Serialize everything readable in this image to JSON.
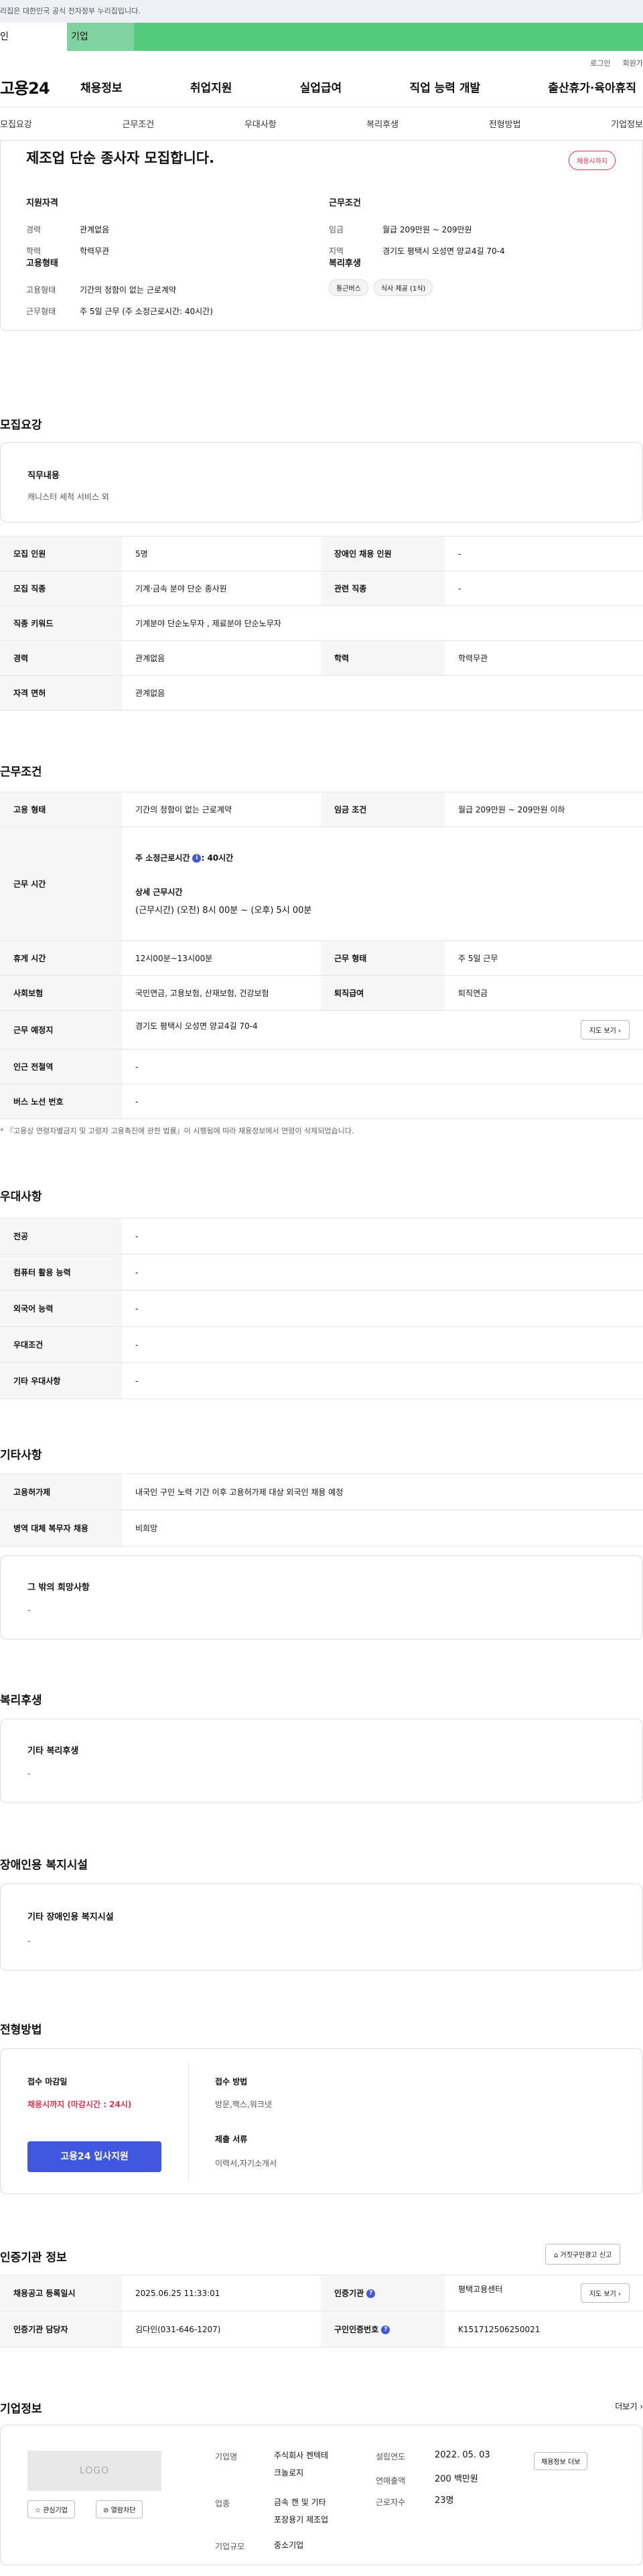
{
  "gov_banner": "이 누리집은 대한민국 공식 전자정부 누리집입니다.",
  "gov_banner_visible": "리집은 대한민국 공식 전자정부 누리집입니다.",
  "portal_tabs": [
    "인",
    "기업"
  ],
  "util": [
    "로그인",
    "회원가"
  ],
  "logo": "고용24",
  "gnb": [
    "채용정보",
    "취업지원",
    "실업급여",
    "직업 능력 개발",
    "출산휴가·육아휴직"
  ],
  "subtabs": [
    "모집요강",
    "근무조건",
    "우대사항",
    "복리후생",
    "전형방법",
    "기업정보"
  ],
  "title": "제조업 단순 종사자 모집합니다.",
  "status_pill": "채용시까지",
  "qual": {
    "heading": "지원자격",
    "rows": [
      {
        "k": "경력",
        "v": "관계없음"
      },
      {
        "k": "학력",
        "v": "학력무관"
      }
    ]
  },
  "emp": {
    "heading": "고용형태",
    "rows": [
      {
        "k": "고용형태",
        "v": "기간의 정함이 없는 근로계약"
      },
      {
        "k": "근무형태",
        "v": "주 5일 근무 (주 소정근로시간: 40시간)"
      }
    ]
  },
  "work": {
    "heading": "근무조건",
    "rows": [
      {
        "k": "임금",
        "v": "월급 209만원 ~ 209만원"
      },
      {
        "k": "지역",
        "v": "경기도 평택시 오성면 양교4길 70-4"
      }
    ]
  },
  "welfare": {
    "heading": "복리후생",
    "tags": [
      "통근버스",
      "식사 제공 (1식)"
    ]
  },
  "sec_recruit": "모집요강",
  "duty": {
    "label": "직무내용",
    "value": "캐니스터 세척 서비스 외"
  },
  "recruit_table": [
    [
      "모집 인원",
      "5명",
      "장애인 채용 인원",
      "-"
    ],
    [
      "모집 직종",
      "기계·금속 분야 단순 종사원",
      "관련 직종",
      "-"
    ],
    [
      "직종 키워드",
      "기계분야 단순노무자 , 제료분야 단순노무자"
    ],
    [
      "경력",
      "관계없음",
      "학력",
      "학력무관"
    ],
    [
      "자격 면허",
      "관계없음"
    ]
  ],
  "sec_work": "근무조건",
  "work_table": {
    "r1": [
      "고용 형태",
      "기간의 정함이 없는 근로계약",
      "임금 조건",
      "월급 209만원 ~ 209만원 이하"
    ],
    "hours_label": "근무 시간",
    "hours_week_label": "주 소정근로시간",
    "hours_week_value": ": 40시간",
    "hours_detail_label": "상세 근무시간",
    "hours_detail_value": "(근무시간) (오전) 8시 00분 ~ (오후) 5시 00분",
    "r3": [
      "휴게 시간",
      "12시00분~13시00분",
      "근무 형태",
      "주 5일 근무"
    ],
    "r4": [
      "사회보험",
      "국민연금, 고용보험, 산재보험, 건강보험",
      "퇴직급여",
      "퇴직연금"
    ],
    "r5": [
      "근무 예정지",
      "경기도 평택시 오성면 양교4길 70-4"
    ],
    "map_btn": "지도 보기 ›",
    "r6": [
      "인근 전철역",
      "-"
    ],
    "r7": [
      "버스 노선 번호",
      "-"
    ]
  },
  "work_note": "* 『고용상 연령차별금지 및 고령자 고용촉진에 관한 법률』이 시행됨에 따라 채용정보에서 연령이 삭제되었습니다.",
  "sec_pref": "우대사항",
  "pref_table": [
    [
      "전공",
      "-"
    ],
    [
      "컴퓨터 활용 능력",
      "-"
    ],
    [
      "외국어 능력",
      "-"
    ],
    [
      "우대조건",
      "-"
    ],
    [
      "기타 우대사항",
      "-"
    ]
  ],
  "sec_etc": "기타사항",
  "etc_table": [
    [
      "고용허가제",
      "내국인 구인 노력 기간 이후 고용허가제 대상 외국인 채용 예정"
    ],
    [
      "병역 대체 복무자 채용",
      "비희망"
    ]
  ],
  "etc_box": {
    "label": "그 밖의 희망사항",
    "value": "-"
  },
  "sec_welfare": "복리후생",
  "welfare_box": {
    "label": "기타 복리후생",
    "value": "-"
  },
  "sec_disabled": "장애인용 복지시설",
  "disabled_box": {
    "label": "기타 장애인용 복지시설",
    "value": "-"
  },
  "sec_select": "전형방법",
  "select": {
    "deadline_label": "접수 마감일",
    "deadline_value": "채용시까지 (마감시간 : 24시)",
    "apply_btn": "고용24 입사지원",
    "method_label": "접수 방법",
    "method_value": "방문,팩스,워크넷",
    "docs_label": "제출 서류",
    "docs_value": "이력서,자기소개서"
  },
  "sec_cert": "인증기관 정보",
  "cert_report_btn": "거짓구인광고 신고",
  "cert_table": {
    "r1": [
      "채용공고 등록일시",
      "2025.06.25 11:33:01",
      "인증기관",
      "평택고용센터"
    ],
    "r2": [
      "인증기관 담당자",
      "김다인(031-646-1207)",
      "구인인증번호",
      "K151712506250021"
    ]
  },
  "sec_company": "기업정보",
  "more": "더보기 ›",
  "company": {
    "logo": "LOGO",
    "fav_btn": "관심기업",
    "block_btn": "열람차단",
    "name_label": "기업명",
    "name_value": [
      "주식회사 켄텍테",
      "크놀로지"
    ],
    "industry_label": "업종",
    "industry_value": [
      "금속 캔 및 기타",
      "포장용기 제조업"
    ],
    "size_label": "기업규모",
    "size_value": "중소기업",
    "founded_label": "설립연도",
    "founded_value": "2022. 05. 03",
    "sales_label": "연매출액",
    "sales_value": "200 백만원",
    "employees_label": "근로자수",
    "employees_value": "23명",
    "jobs_btn": "채용정보 더보"
  }
}
